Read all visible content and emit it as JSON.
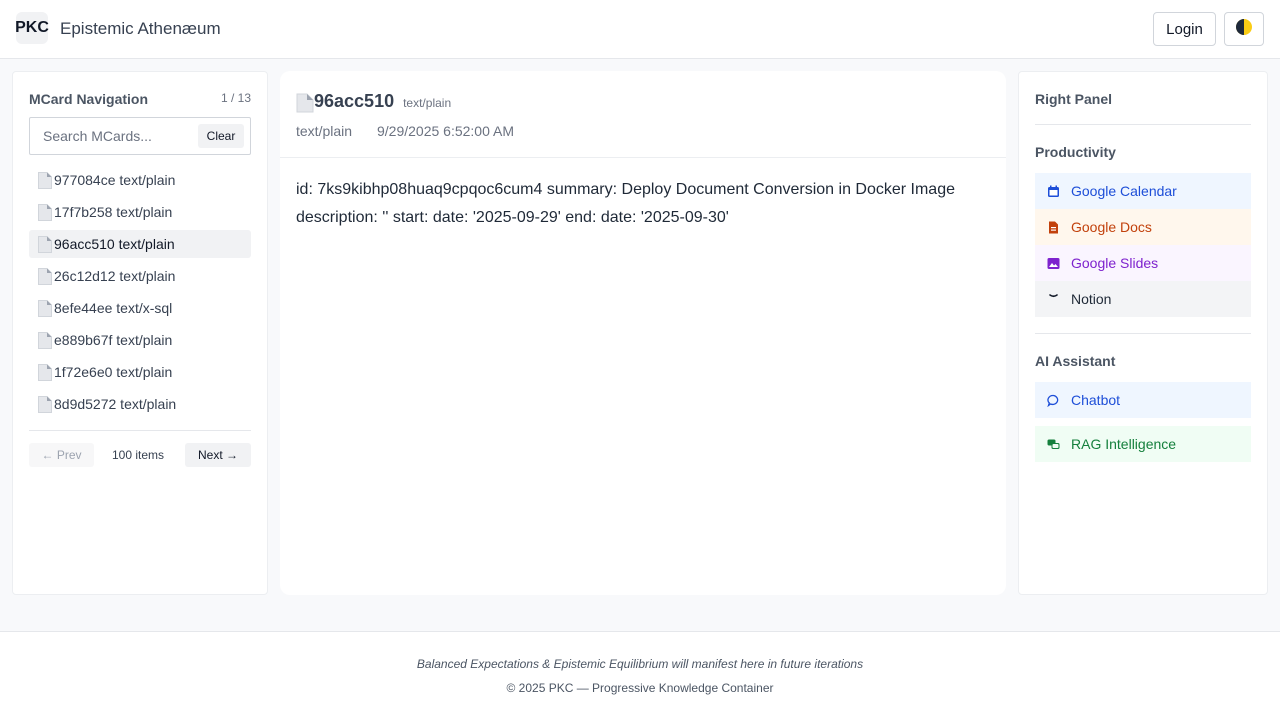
{
  "header": {
    "logo_text": "PKC",
    "app_title": "Epistemic Athenæum",
    "login_label": "Login",
    "theme_icon": "half-moon-icon"
  },
  "navigation": {
    "title": "MCard Navigation",
    "page_indicator": "1 / 13",
    "search_placeholder": "Search MCards...",
    "clear_label": "Clear",
    "items": [
      {
        "label": "977084ce text/plain",
        "active": false
      },
      {
        "label": "17f7b258 text/plain",
        "active": false
      },
      {
        "label": "96acc510 text/plain",
        "active": true
      },
      {
        "label": "26c12d12 text/plain",
        "active": false
      },
      {
        "label": "8efe44ee text/x-sql",
        "active": false
      },
      {
        "label": "e889b67f text/plain",
        "active": false
      },
      {
        "label": "1f72e6e0 text/plain",
        "active": false
      },
      {
        "label": "8d9d5272 text/plain",
        "active": false
      }
    ],
    "prev_label": "← Prev",
    "items_count": "100 items",
    "next_label": "Next →"
  },
  "card": {
    "title": "96acc510",
    "badge": "text/plain",
    "type": "text/plain",
    "date": "9/29/2025 6:52:00 AM",
    "content": "id: 7ks9kibhp08huaq9cpqoc6cum4 summary: Deploy Document Conversion in Docker Image description: '' start: date: '2025-09-29' end: date: '2025-09-30'"
  },
  "right_panel": {
    "title": "Right Panel",
    "productivity_title": "Productivity",
    "productivity_links": [
      {
        "label": "Google Calendar",
        "icon": "calendar-icon",
        "color": "#1d4ed8",
        "bg": "#eff6ff"
      },
      {
        "label": "Google Docs",
        "icon": "document-icon",
        "color": "#c2410c",
        "bg": "#fff7ed"
      },
      {
        "label": "Google Slides",
        "icon": "image-icon",
        "color": "#7e22ce",
        "bg": "#faf5ff"
      },
      {
        "label": "Notion",
        "icon": "notion-icon",
        "color": "#1f2937",
        "bg": "#f3f4f6"
      }
    ],
    "ai_title": "AI Assistant",
    "ai_links": [
      {
        "label": "Chatbot",
        "icon": "chat-bubble-icon",
        "color": "#1d4ed8",
        "bg": "#eff6ff"
      },
      {
        "label": "RAG Intelligence",
        "icon": "chat-bubbles-icon",
        "color": "#15803d",
        "bg": "#f0fdf4"
      }
    ]
  },
  "footer": {
    "note": "Balanced Expectations & Epistemic Equilibrium will manifest here in future iterations",
    "copyright": "© 2025 PKC — Progressive Knowledge Container"
  }
}
